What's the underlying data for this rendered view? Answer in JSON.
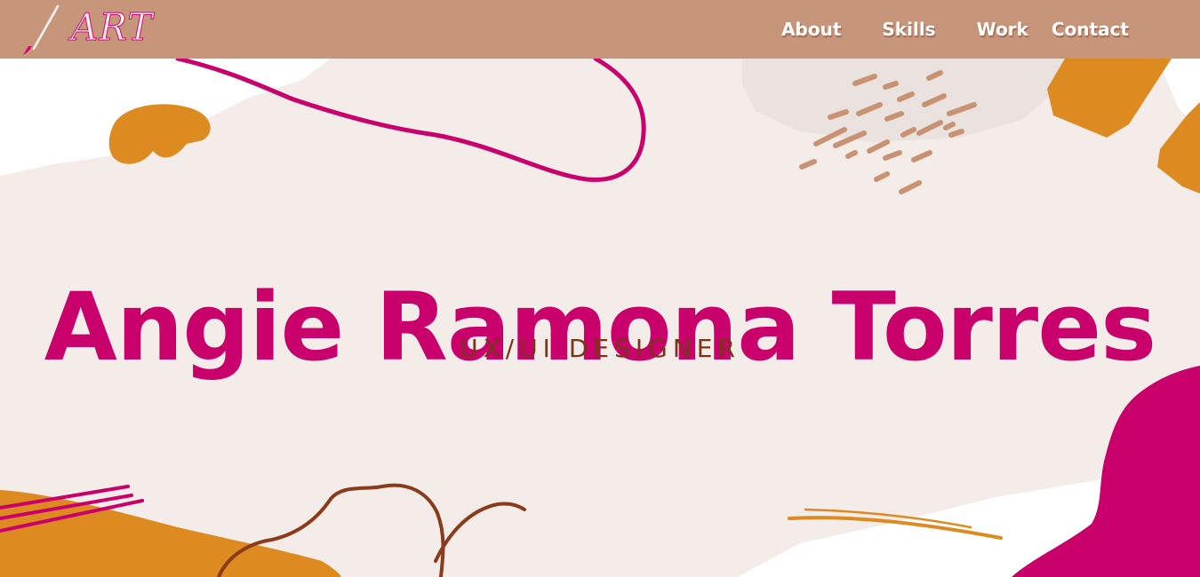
{
  "brand": {
    "logo_text": "ART"
  },
  "nav": {
    "items": [
      "About",
      "Skills",
      "Work",
      "Contact"
    ]
  },
  "hero": {
    "name": "Angie Ramona Torres",
    "role": "UX/UI DESIGNER"
  },
  "colors": {
    "nav_background": "#c79579",
    "page_background": "#f3ece8",
    "accent_magenta": "#c9006b",
    "accent_orange": "#dd8a20",
    "role_brown": "#7a3418"
  }
}
